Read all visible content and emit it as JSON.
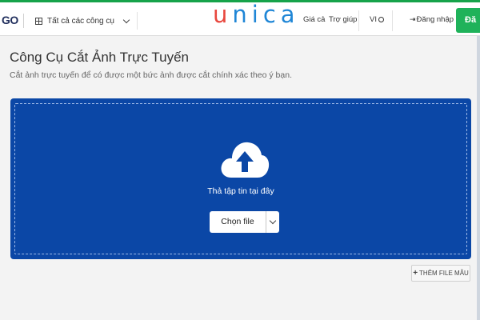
{
  "header": {
    "logo_text": "GO",
    "tools_menu_label": "Tất cả các công cụ",
    "brand_letters": [
      "u",
      "n",
      "i",
      "c",
      "a"
    ],
    "brand_colors": {
      "primary": "#e8473e",
      "secondary": "#1f86d6"
    },
    "nav": {
      "all_label": "Giá cả",
      "help_label": "Trợ giúp",
      "lang_label": "VI",
      "login_label": "Đăng nhập",
      "signup_label": "Đă"
    }
  },
  "main": {
    "title": "Công Cụ Cắt Ảnh Trực Tuyến",
    "subtitle": "Cắt ảnh trực tuyến để có được một bức ảnh được cắt chính xác theo ý bạn.",
    "dropzone": {
      "drop_label": "Thả tập tin tại đây",
      "choose_file_label": "Chọn file",
      "background_color": "#0b47a6"
    },
    "sample_files_label": "THÊM FILE MẪU"
  },
  "icons": {
    "grid": "grid-icon",
    "chevron": "chevron-down-icon",
    "globe": "globe-icon",
    "login": "login-icon",
    "upload": "cloud-upload-icon",
    "plus": "plus-icon"
  }
}
